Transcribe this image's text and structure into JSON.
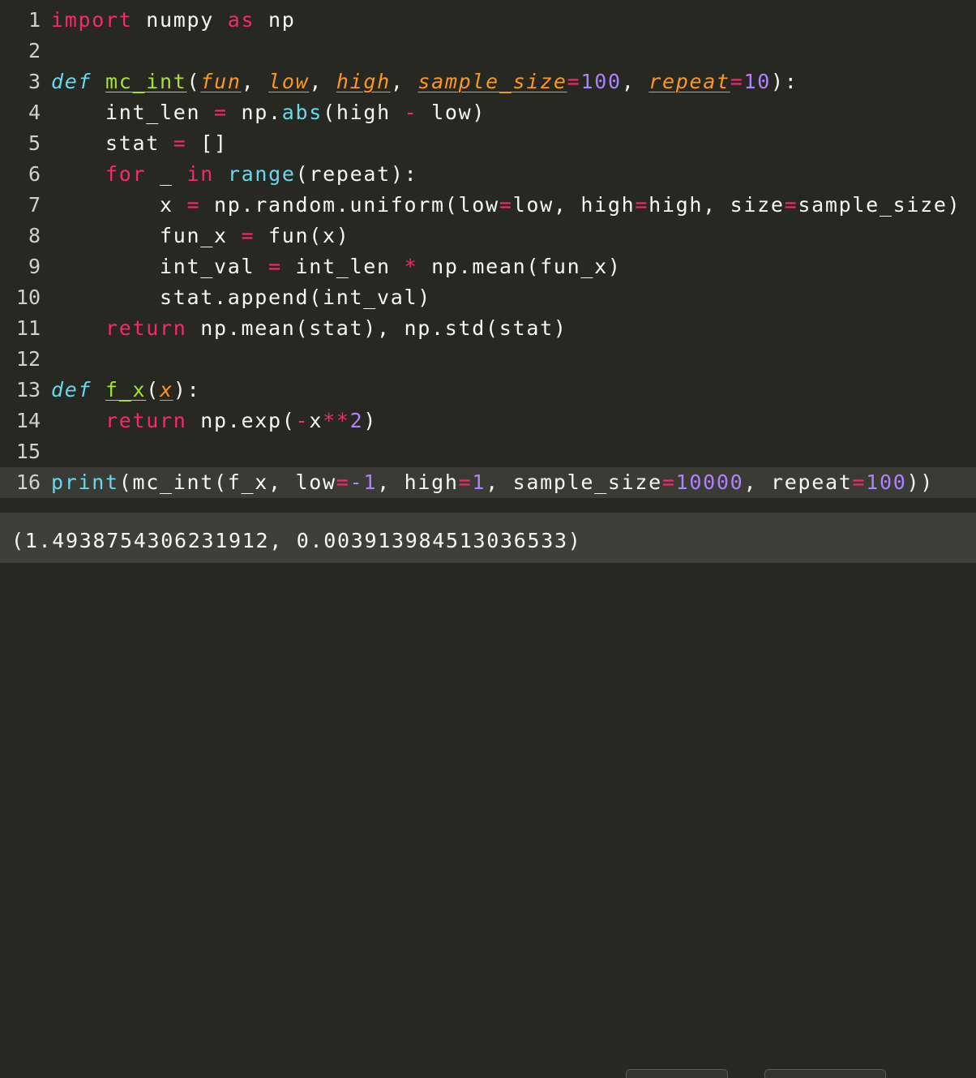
{
  "editor": {
    "lines": [
      {
        "num": "1",
        "tokens": [
          [
            "kw",
            "import"
          ],
          [
            "p",
            " numpy "
          ],
          [
            "kw",
            "as"
          ],
          [
            "p",
            " np"
          ]
        ]
      },
      {
        "num": "2",
        "tokens": []
      },
      {
        "num": "3",
        "tokens": [
          [
            "def",
            "def"
          ],
          [
            "p",
            " "
          ],
          [
            "fn",
            "mc_int"
          ],
          [
            "p",
            "("
          ],
          [
            "param",
            "fun"
          ],
          [
            "p",
            ", "
          ],
          [
            "param",
            "low"
          ],
          [
            "p",
            ", "
          ],
          [
            "param",
            "high"
          ],
          [
            "p",
            ", "
          ],
          [
            "param",
            "sample_size"
          ],
          [
            "op",
            "="
          ],
          [
            "num",
            "100"
          ],
          [
            "p",
            ", "
          ],
          [
            "param",
            "repeat"
          ],
          [
            "op",
            "="
          ],
          [
            "num",
            "10"
          ],
          [
            "p",
            "):"
          ]
        ]
      },
      {
        "num": "4",
        "tokens": [
          [
            "p",
            "    int_len "
          ],
          [
            "op",
            "="
          ],
          [
            "p",
            " np."
          ],
          [
            "bi",
            "abs"
          ],
          [
            "p",
            "(high "
          ],
          [
            "op",
            "-"
          ],
          [
            "p",
            " low)"
          ]
        ]
      },
      {
        "num": "5",
        "tokens": [
          [
            "p",
            "    stat "
          ],
          [
            "op",
            "="
          ],
          [
            "p",
            " []"
          ]
        ]
      },
      {
        "num": "6",
        "tokens": [
          [
            "p",
            "    "
          ],
          [
            "kw",
            "for"
          ],
          [
            "p",
            " _ "
          ],
          [
            "kw",
            "in"
          ],
          [
            "p",
            " "
          ],
          [
            "bi",
            "range"
          ],
          [
            "p",
            "(repeat):"
          ]
        ]
      },
      {
        "num": "7",
        "tokens": [
          [
            "p",
            "        x "
          ],
          [
            "op",
            "="
          ],
          [
            "p",
            " np.random.uniform(low"
          ],
          [
            "op",
            "="
          ],
          [
            "p",
            "low, high"
          ],
          [
            "op",
            "="
          ],
          [
            "p",
            "high, size"
          ],
          [
            "op",
            "="
          ],
          [
            "p",
            "sample_size)"
          ]
        ]
      },
      {
        "num": "8",
        "tokens": [
          [
            "p",
            "        fun_x "
          ],
          [
            "op",
            "="
          ],
          [
            "p",
            " fun(x)"
          ]
        ]
      },
      {
        "num": "9",
        "tokens": [
          [
            "p",
            "        int_val "
          ],
          [
            "op",
            "="
          ],
          [
            "p",
            " int_len "
          ],
          [
            "op",
            "*"
          ],
          [
            "p",
            " np.mean(fun_x)"
          ]
        ]
      },
      {
        "num": "10",
        "tokens": [
          [
            "p",
            "        stat.append(int_val)"
          ]
        ]
      },
      {
        "num": "11",
        "tokens": [
          [
            "p",
            "    "
          ],
          [
            "kw",
            "return"
          ],
          [
            "p",
            " np.mean(stat), np.std(stat)"
          ]
        ]
      },
      {
        "num": "12",
        "tokens": []
      },
      {
        "num": "13",
        "tokens": [
          [
            "def",
            "def"
          ],
          [
            "p",
            " "
          ],
          [
            "fn",
            "f_x"
          ],
          [
            "p",
            "("
          ],
          [
            "param",
            "x"
          ],
          [
            "p",
            "):"
          ]
        ]
      },
      {
        "num": "14",
        "tokens": [
          [
            "p",
            "    "
          ],
          [
            "kw",
            "return"
          ],
          [
            "p",
            " np.exp("
          ],
          [
            "op",
            "-"
          ],
          [
            "p",
            "x"
          ],
          [
            "op",
            "**"
          ],
          [
            "num",
            "2"
          ],
          [
            "p",
            ")"
          ]
        ]
      },
      {
        "num": "15",
        "tokens": []
      },
      {
        "num": "16",
        "active": true,
        "tokens": [
          [
            "bi",
            "print"
          ],
          [
            "p",
            "(mc_int(f_x, low"
          ],
          [
            "op",
            "="
          ],
          [
            "num",
            "-1"
          ],
          [
            "p",
            ", high"
          ],
          [
            "op",
            "="
          ],
          [
            "num",
            "1"
          ],
          [
            "p",
            ", sample_size"
          ],
          [
            "op",
            "="
          ],
          [
            "num",
            "10000"
          ],
          [
            "p",
            ", repeat"
          ],
          [
            "op",
            "="
          ],
          [
            "num",
            "100"
          ],
          [
            "p",
            "))"
          ]
        ]
      }
    ]
  },
  "output": {
    "text": "(1.4938754306231912, 0.003913984513036533)"
  },
  "colors": {
    "background": "#272822",
    "output_background": "#3e3f3a",
    "keyword": "#f92672",
    "definition": "#66d9ef",
    "function_name": "#a6e22e",
    "parameter": "#fd971f",
    "number": "#ae81ff"
  }
}
